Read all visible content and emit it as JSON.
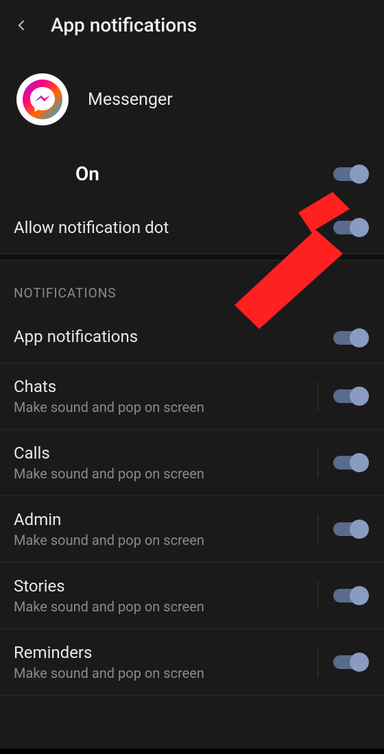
{
  "header": {
    "title": "App notifications"
  },
  "app": {
    "name": "Messenger",
    "icon_name": "messenger-icon"
  },
  "master": {
    "label": "On",
    "state": true
  },
  "dot": {
    "label": "Allow notification dot",
    "state": true
  },
  "section_header": "NOTIFICATIONS",
  "app_notifications": {
    "label": "App notifications",
    "state": true
  },
  "channels": [
    {
      "title": "Chats",
      "subtitle": "Make sound and pop on screen",
      "state": true
    },
    {
      "title": "Calls",
      "subtitle": "Make sound and pop on screen",
      "state": true
    },
    {
      "title": "Admin",
      "subtitle": "Make sound and pop on screen",
      "state": true
    },
    {
      "title": "Stories",
      "subtitle": "Make sound and pop on screen",
      "state": true
    },
    {
      "title": "Reminders",
      "subtitle": "Make sound and pop on screen",
      "state": true
    }
  ],
  "colors": {
    "background": "#1a1a1a",
    "toggle_track": "#5a6b8c",
    "toggle_thumb": "#8a9bc2",
    "annotation_arrow": "#ff2020"
  }
}
